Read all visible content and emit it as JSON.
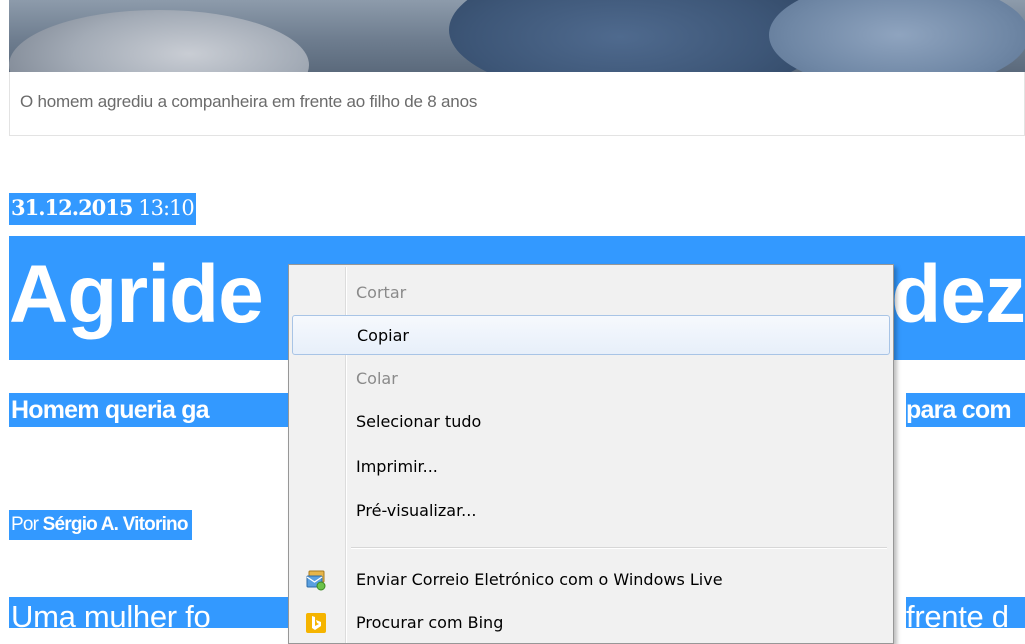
{
  "article": {
    "caption": "O homem agrediu a companheira em frente ao filho de 8 anos",
    "date": "31.12.2015",
    "time": "13:10",
    "title_left": "Agride",
    "title_right": "dez",
    "subtitle_left": "Homem queria ga",
    "subtitle_right": "para com",
    "byline_prefix": "Por",
    "byline_author": "Sérgio A. Vitorino",
    "lead_left": "Uma mulher fo",
    "lead_right": "frente d"
  },
  "context_menu": {
    "items": [
      {
        "label": "Cortar",
        "enabled": false
      },
      {
        "label": "Copiar",
        "enabled": true
      },
      {
        "label": "Colar",
        "enabled": false
      },
      {
        "label": "Selecionar tudo",
        "enabled": true
      },
      {
        "label": "Imprimir...",
        "enabled": true
      },
      {
        "label": "Pré-visualizar...",
        "enabled": true
      },
      {
        "label": "Enviar Correio Eletrónico com o Windows Live",
        "enabled": true,
        "icon": "windows-live-mail-icon"
      },
      {
        "label": "Procurar com Bing",
        "enabled": true,
        "icon": "bing-icon"
      }
    ]
  },
  "colors": {
    "selection": "#3399ff",
    "menu_bg": "#f1f1f1",
    "menu_hover_border": "#a8c4e6"
  }
}
